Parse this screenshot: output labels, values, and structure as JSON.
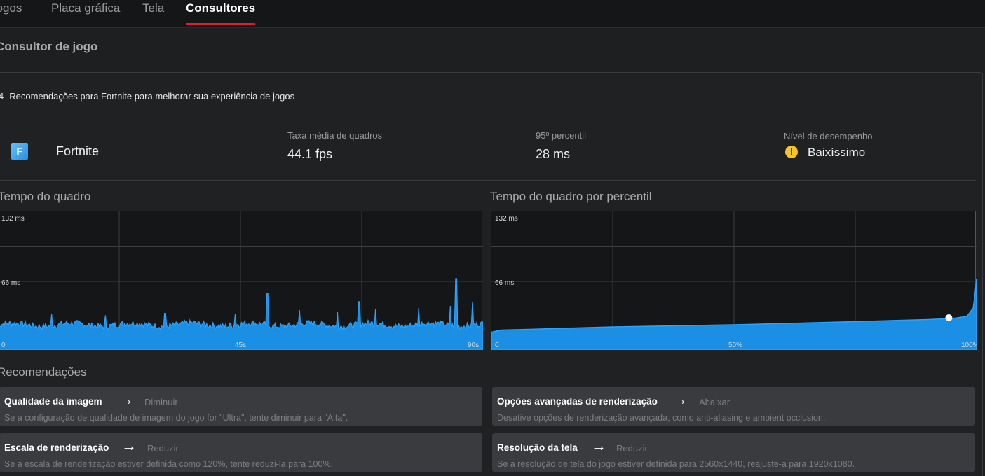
{
  "tabs": [
    {
      "label": "Jogos"
    },
    {
      "label": "Placa gráfica"
    },
    {
      "label": "Tela"
    },
    {
      "label": "Consultores"
    }
  ],
  "section_title": "Consultor de jogo",
  "rec_count": "4",
  "rec_summary": "Recomendações para Fortnite para melhorar sua experiência de jogos",
  "game": {
    "icon_letter": "F",
    "name": "Fortnite",
    "stats": [
      {
        "label": "Taxa média de quadros",
        "value": "44.1 fps"
      },
      {
        "label": "95º percentil",
        "value": "28 ms"
      },
      {
        "label": "Nível de desempenho",
        "value": "Baixíssimo"
      }
    ],
    "warning_icon": "!"
  },
  "colors": {
    "accent": "#e31937",
    "series": "#1a8fe3",
    "series_line": "#2aa3ff",
    "warning": "#f5c42c"
  },
  "chart_data": [
    {
      "type": "area",
      "title": "Tempo do quadro",
      "y_ticks": [
        "132  ms",
        "66  ms"
      ],
      "x_ticks": [
        "0",
        "45s",
        "90s"
      ],
      "ylim": [
        0,
        132
      ],
      "xlim": [
        0,
        90
      ],
      "baseline_ms": 24,
      "spikes": [
        {
          "x": 10,
          "y": 34
        },
        {
          "x": 20,
          "y": 33
        },
        {
          "x": 31,
          "y": 35
        },
        {
          "x": 44,
          "y": 34
        },
        {
          "x": 50,
          "y": 54
        },
        {
          "x": 56,
          "y": 38
        },
        {
          "x": 63,
          "y": 36
        },
        {
          "x": 67,
          "y": 46
        },
        {
          "x": 70,
          "y": 39
        },
        {
          "x": 78,
          "y": 40
        },
        {
          "x": 84,
          "y": 42
        },
        {
          "x": 85,
          "y": 68
        },
        {
          "x": 88,
          "y": 46
        }
      ],
      "grid": true
    },
    {
      "type": "area",
      "title": "Tempo do quadro por percentil",
      "y_ticks": [
        "132  ms",
        "66  ms"
      ],
      "x_ticks": [
        "0",
        "50%",
        "100%"
      ],
      "ylim": [
        0,
        132
      ],
      "xlim": [
        0,
        100
      ],
      "points": [
        {
          "x": 0,
          "y": 17
        },
        {
          "x": 2,
          "y": 19
        },
        {
          "x": 10,
          "y": 20
        },
        {
          "x": 25,
          "y": 22
        },
        {
          "x": 50,
          "y": 24
        },
        {
          "x": 75,
          "y": 27
        },
        {
          "x": 90,
          "y": 29
        },
        {
          "x": 95,
          "y": 30
        },
        {
          "x": 98,
          "y": 32
        },
        {
          "x": 99.3,
          "y": 40
        },
        {
          "x": 99.7,
          "y": 54
        },
        {
          "x": 100,
          "y": 68
        }
      ],
      "marker": {
        "x": 95,
        "y": 30
      },
      "grid": true
    }
  ],
  "recommendations_heading": "Recomendações",
  "recommendations": [
    {
      "title": "Qualidade da imagem",
      "action": "Diminuir",
      "desc": "Se a configuração de qualidade de imagem do jogo for \"Ultra\", tente diminuir para \"Alta\"."
    },
    {
      "title": "Opções avançadas de renderização",
      "action": "Abaixar",
      "desc": "Desative opções de renderização avançada, como anti-aliasing e ambient occlusion."
    },
    {
      "title": "Escala de renderização",
      "action": "Reduzir",
      "desc": "Se a escala de renderização estiver definida como 120%, tente reduzi-la para 100%."
    },
    {
      "title": "Resolução da tela",
      "action": "Reduzir",
      "desc": "Se a resolução de tela do jogo estiver definida para 2560x1440, reajuste-a para 1920x1080."
    }
  ]
}
